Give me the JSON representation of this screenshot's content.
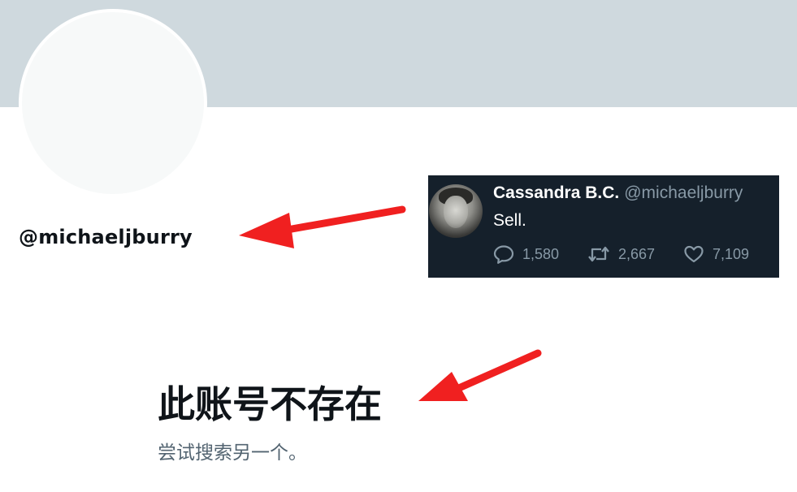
{
  "profile": {
    "handle": "@michaeljburry",
    "banner_color": "#cfd9de",
    "avatar_color": "#f7f9f9"
  },
  "tweet": {
    "display_name": "Cassandra B.C.",
    "username": "@michaeljburry",
    "text": "Sell.",
    "replies": "1,580",
    "retweets": "2,667",
    "likes": "7,109",
    "icons": [
      "reply-icon",
      "retweet-icon",
      "like-icon"
    ],
    "background_color": "#15202b"
  },
  "notice": {
    "title": "此账号不存在",
    "subtitle": "尝试搜索另一个。"
  },
  "annotation": {
    "arrow_color": "#f02020"
  }
}
